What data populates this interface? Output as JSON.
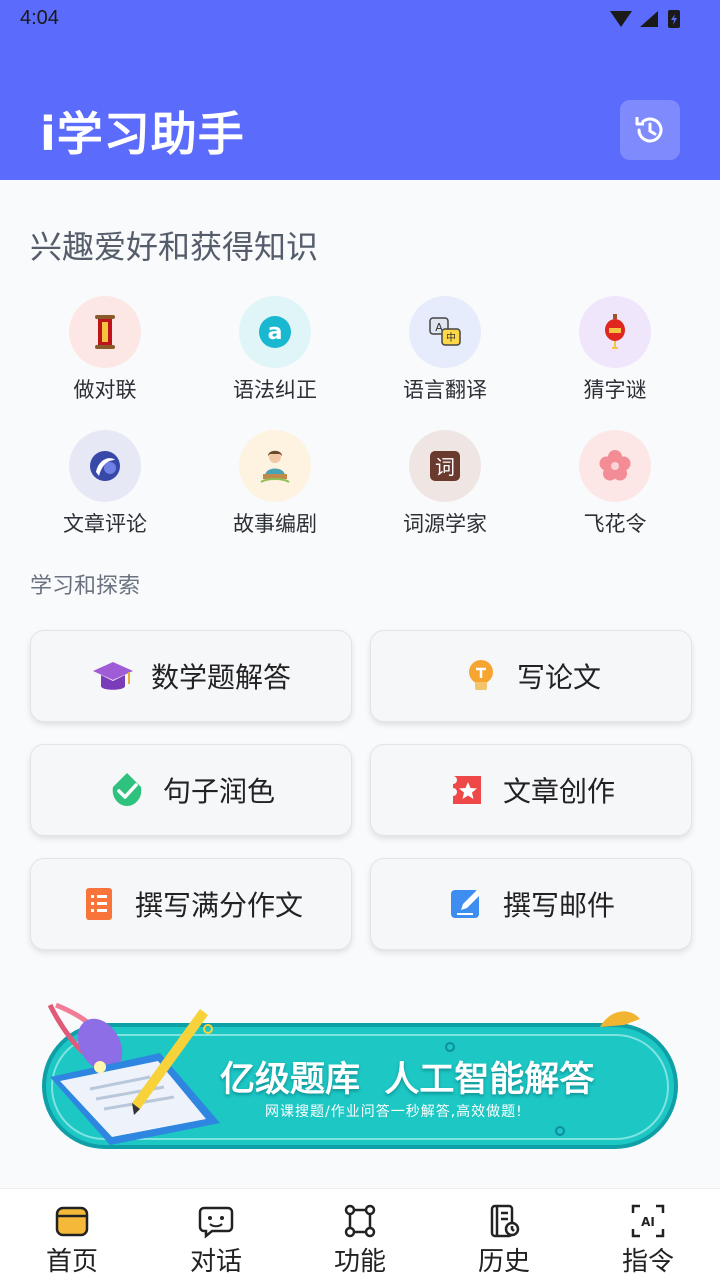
{
  "status_bar": {
    "time": "4:04"
  },
  "header": {
    "title": "i学习助手",
    "history_icon": "history-icon"
  },
  "section_interest": {
    "title": "兴趣爱好和获得知识",
    "items": [
      {
        "label": "做对联",
        "icon": "scroll-icon",
        "bg": "#fde7e4"
      },
      {
        "label": "语法纠正",
        "icon": "letter-a-icon",
        "bg": "#dff5f8"
      },
      {
        "label": "语言翻译",
        "icon": "translate-icon",
        "bg": "#e6ecfb"
      },
      {
        "label": "猜字谜",
        "icon": "lantern-icon",
        "bg": "#f0e6fb"
      },
      {
        "label": "文章评论",
        "icon": "moon-swirl-icon",
        "bg": "#e6e8f5"
      },
      {
        "label": "故事编剧",
        "icon": "storyteller-icon",
        "bg": "#fdf3e0"
      },
      {
        "label": "词源学家",
        "icon": "ci-character-icon",
        "bg": "#efe6e4"
      },
      {
        "label": "飞花令",
        "icon": "flower-icon",
        "bg": "#fde6e6"
      }
    ]
  },
  "section_learning": {
    "title": "学习和探索",
    "cards": [
      {
        "label": "数学题解答",
        "icon": "graduation-cap-icon"
      },
      {
        "label": "写论文",
        "icon": "lightbulb-icon"
      },
      {
        "label": "句子润色",
        "icon": "leaf-check-icon"
      },
      {
        "label": "文章创作",
        "icon": "ticket-star-icon"
      },
      {
        "label": "撰写满分作文",
        "icon": "list-document-icon"
      },
      {
        "label": "撰写邮件",
        "icon": "edit-note-icon"
      }
    ]
  },
  "banner": {
    "headline": "亿级题库  人工智能解答",
    "subline": "网课搜题/作业问答一秒解答,高效做题!"
  },
  "tabbar": {
    "items": [
      {
        "label": "首页",
        "icon": "home-folder-icon",
        "active": true
      },
      {
        "label": "对话",
        "icon": "chat-bubble-icon",
        "active": false
      },
      {
        "label": "功能",
        "icon": "nodes-icon",
        "active": false
      },
      {
        "label": "历史",
        "icon": "history-book-icon",
        "active": false
      },
      {
        "label": "指令",
        "icon": "ai-command-icon",
        "active": false
      }
    ]
  },
  "colors": {
    "primary": "#5b6bfb",
    "banner_teal": "#12c0c0"
  }
}
